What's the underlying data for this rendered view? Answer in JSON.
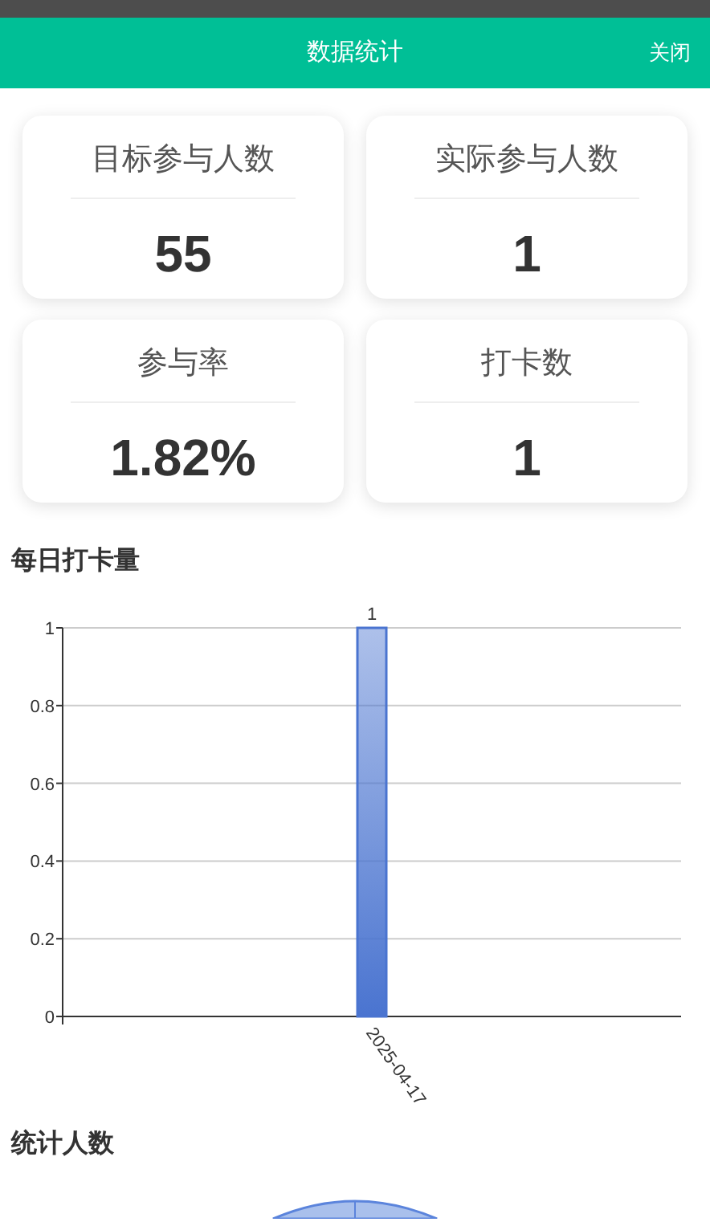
{
  "header": {
    "title": "数据统计",
    "close": "关闭"
  },
  "stats": [
    {
      "label": "目标参与人数",
      "value": "55"
    },
    {
      "label": "实际参与人数",
      "value": "1"
    },
    {
      "label": "参与率",
      "value": "1.82%"
    },
    {
      "label": "打卡数",
      "value": "1"
    }
  ],
  "daily_section": {
    "title": "每日打卡量",
    "chart_data": {
      "type": "bar",
      "categories": [
        "2025-04-17"
      ],
      "series": [
        {
          "color": "#4a74d0",
          "values": [
            1
          ]
        }
      ],
      "grid": true,
      "ylim": [
        0,
        1
      ],
      "yticks": [
        0,
        0.2,
        0.4,
        0.6,
        0.8,
        1
      ],
      "data_labels": true
    }
  },
  "people_section": {
    "title": "统计人数"
  }
}
